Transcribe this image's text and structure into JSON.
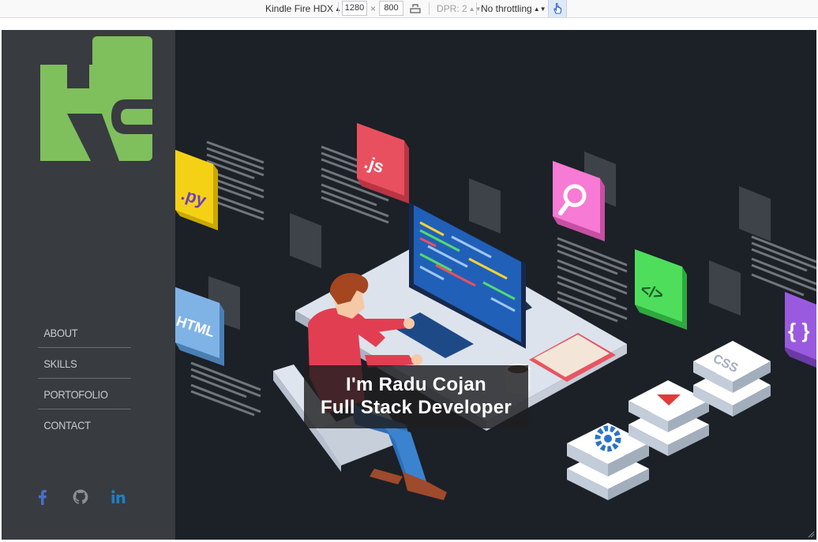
{
  "toolbar": {
    "device": "Kindle Fire HDX",
    "width": "1280",
    "times": "×",
    "height": "800",
    "dpr": "DPR: 2",
    "throttling": "No throttling"
  },
  "sidebar": {
    "nav": [
      {
        "label": "ABOUT"
      },
      {
        "label": "SKILLS"
      },
      {
        "label": "PORTOFOLIO"
      },
      {
        "label": "CONTACT"
      }
    ],
    "social": [
      "facebook-icon",
      "github-icon",
      "linkedin-icon"
    ]
  },
  "hero": {
    "line1": "I'm Radu Cojan",
    "line2": "Full Stack Developer",
    "tiles": {
      "py": ".py",
      "js": ".js",
      "html": "HTML",
      "css": "CSS",
      "code": "</>",
      "braces": "{ }"
    }
  },
  "colors": {
    "sidebar": "#383b40",
    "hero_bg": "#1c2027",
    "logo_green": "#7fbf5c",
    "facebook": "#4a6fc9",
    "linkedin": "#1d7fc4"
  }
}
